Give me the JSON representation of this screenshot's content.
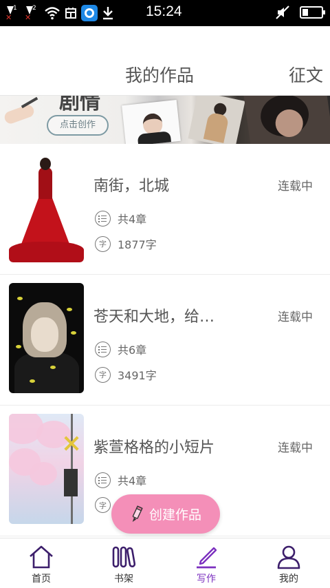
{
  "status_bar": {
    "time": "15:24",
    "sim1_label": "1",
    "sim2_label": "2",
    "battery_level": 0.3
  },
  "header": {
    "tab_my_works": "我的作品",
    "tab_essay": "征文"
  },
  "banner": {
    "title_fragment": "剧情",
    "button_label": "点击创作"
  },
  "works": [
    {
      "title": "南街，北城",
      "status": "连载中",
      "chapters": "共4章",
      "words": "1877字"
    },
    {
      "title": "苍天和大地，给…",
      "status": "连载中",
      "chapters": "共6章",
      "words": "3491字"
    },
    {
      "title": "紫萱格格的小短片",
      "status": "连载中",
      "chapters": "共4章",
      "words": ""
    }
  ],
  "meta_icons": {
    "chapters": "list-icon",
    "words_glyph": "字"
  },
  "fab": {
    "label": "创建作品",
    "color": "#f48fb8"
  },
  "bottom_nav": {
    "items": [
      {
        "label": "首页",
        "icon": "home-icon"
      },
      {
        "label": "书架",
        "icon": "bookshelf-icon"
      },
      {
        "label": "写作",
        "icon": "write-icon"
      },
      {
        "label": "我的",
        "icon": "user-icon"
      }
    ],
    "active_color": "#7b2fbf",
    "icon_color": "#3c1e6b"
  }
}
